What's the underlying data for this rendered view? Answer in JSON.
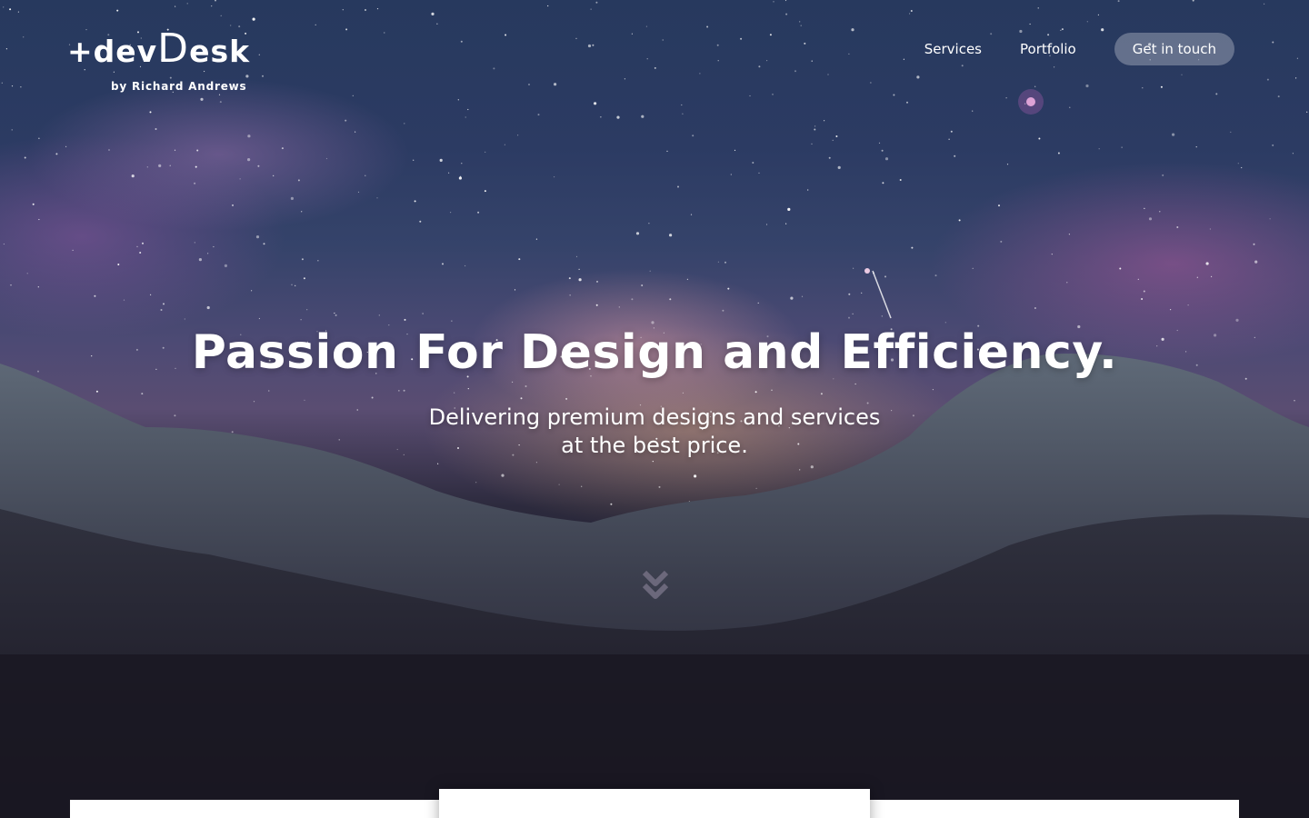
{
  "brand": {
    "logo_prefix": "+dev",
    "logo_d": "D",
    "logo_suffix": "esk",
    "byline": "by Richard Andrews"
  },
  "nav": {
    "items": [
      {
        "label": "Services"
      },
      {
        "label": "Portfolio"
      }
    ],
    "cta_label": "Get in touch"
  },
  "hero": {
    "headline": "Passion For Design and Efficiency.",
    "subline_1": "Delivering premium designs and services",
    "subline_2": "at the best price."
  },
  "icons": {
    "scroll": "double-chevron-down-icon"
  },
  "colors": {
    "text": "#ffffff",
    "cta_background": "rgba(255,255,255,0.28)",
    "card": "#ffffff"
  }
}
